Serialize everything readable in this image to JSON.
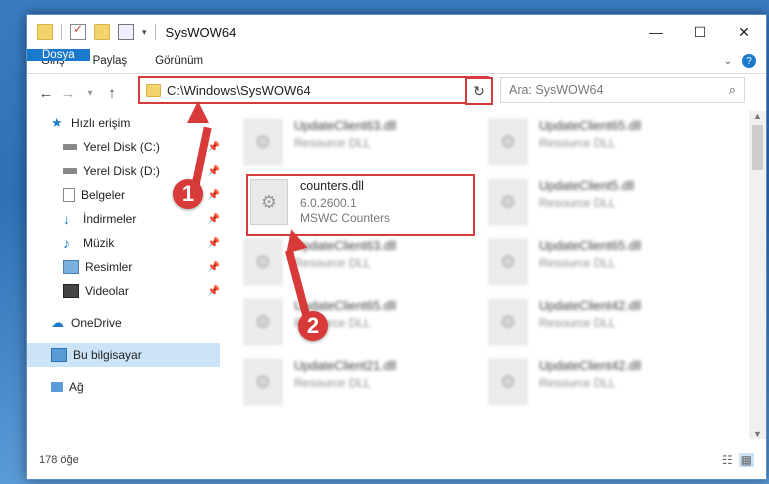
{
  "window": {
    "title": "SysWOW64",
    "controls": {
      "minimize": "—",
      "maximize": "☐",
      "close": "✕"
    }
  },
  "ribbon": {
    "tabs": [
      "Dosya",
      "Giriş",
      "Paylaş",
      "Görünüm"
    ]
  },
  "address": {
    "path": "C:\\Windows\\SysWOW64",
    "dropdown_icon": "chevron-down-icon",
    "refresh_icon": "refresh-icon"
  },
  "search": {
    "placeholder": "Ara: SysWOW64",
    "icon": "search-icon"
  },
  "sidebar": {
    "items": [
      {
        "label": "Hızlı erişim",
        "icon": "star-icon",
        "pinned": false
      },
      {
        "label": "Yerel Disk (C:)",
        "icon": "drive-icon",
        "pinned": true
      },
      {
        "label": "Yerel Disk (D:)",
        "icon": "drive-icon",
        "pinned": true
      },
      {
        "label": "Belgeler",
        "icon": "document-icon",
        "pinned": true
      },
      {
        "label": "İndirmeler",
        "icon": "download-icon",
        "pinned": true
      },
      {
        "label": "Müzik",
        "icon": "music-icon",
        "pinned": true
      },
      {
        "label": "Resimler",
        "icon": "picture-icon",
        "pinned": true
      },
      {
        "label": "Videolar",
        "icon": "video-icon",
        "pinned": true
      },
      {
        "label": "OneDrive",
        "icon": "cloud-icon",
        "pinned": false
      },
      {
        "label": "Bu bilgisayar",
        "icon": "computer-icon",
        "pinned": false,
        "active": true
      },
      {
        "label": "Ağ",
        "icon": "network-icon",
        "pinned": false
      }
    ]
  },
  "files": {
    "highlighted": {
      "name": "counters.dll",
      "version": "6.0.2600.1",
      "description": "MSWC Counters"
    },
    "left_column": [
      {
        "name": "UpdateClient63.dll",
        "type": "Resource DLL"
      },
      {
        "name": "UpdateClient63.dll",
        "type": "Resource DLL"
      },
      {
        "name": "UpdateClient65.dll",
        "type": "Resource DLL"
      },
      {
        "name": "UpdateClient21.dll",
        "type": "Resource DLL"
      }
    ],
    "right_column": [
      {
        "name": "UpdateClient65.dll",
        "type": "Resource DLL"
      },
      {
        "name": "UpdateClient5.dll",
        "type": "Resource DLL"
      },
      {
        "name": "UpdateClient65.dll",
        "type": "Resource DLL"
      },
      {
        "name": "UpdateClient42.dll",
        "type": "Resource DLL"
      },
      {
        "name": "UpdateClient42.dll",
        "type": "Resource DLL"
      }
    ]
  },
  "status": {
    "count": "178 öğe"
  },
  "callouts": [
    "1",
    "2"
  ],
  "colors": {
    "accent": "#1979ca",
    "highlight": "#d83a3a",
    "active_bg": "#cce4f7"
  }
}
